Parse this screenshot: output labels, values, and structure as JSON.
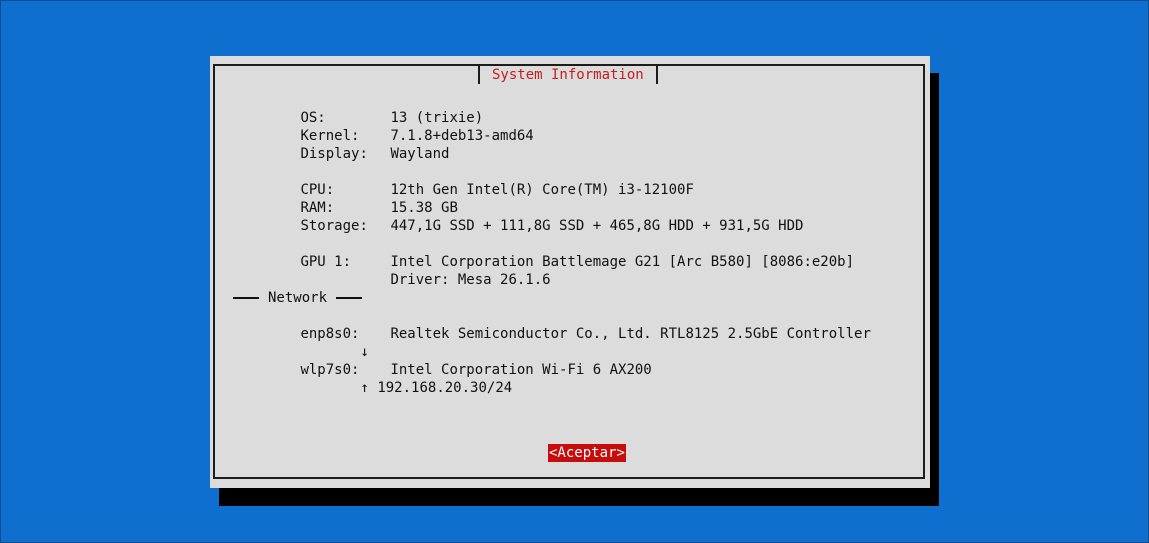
{
  "dialog": {
    "title": "System Information",
    "info": {
      "os_label": "OS:",
      "os_value": "13 (trixie)",
      "kernel_label": "Kernel:",
      "kernel_value": "7.1.8+deb13-amd64",
      "display_label": "Display:",
      "display_value": "Wayland",
      "cpu_label": "CPU:",
      "cpu_value": "12th Gen Intel(R) Core(TM) i3-12100F",
      "ram_label": "RAM:",
      "ram_value": "15.38 GB",
      "storage_label": "Storage:",
      "storage_value": "447,1G SSD + 111,8G SSD + 465,8G HDD + 931,5G HDD",
      "gpu_label": "GPU 1:",
      "gpu_value": "Intel Corporation Battlemage G21 [Arc B580] [8086:e20b]",
      "gpu_driver": "Driver: Mesa 26.1.6"
    },
    "network": {
      "header": "Network",
      "interfaces": [
        {
          "name": "enp8s0:",
          "device": "Realtek Semiconductor Co., Ltd. RTL8125 2.5GbE Controller",
          "status_arrow": "↓",
          "address": ""
        },
        {
          "name": "wlp7s0:",
          "device": "Intel Corporation Wi-Fi 6 AX200",
          "status_arrow": "↑",
          "address": "192.168.20.30/24"
        }
      ]
    },
    "ok_button": "<Aceptar>"
  },
  "colors": {
    "background": "#0e6fce",
    "dialog": "#dcdcdc",
    "title_text": "#c81d1d",
    "button_bg": "#c70c0c",
    "button_text": "#ffffff"
  }
}
